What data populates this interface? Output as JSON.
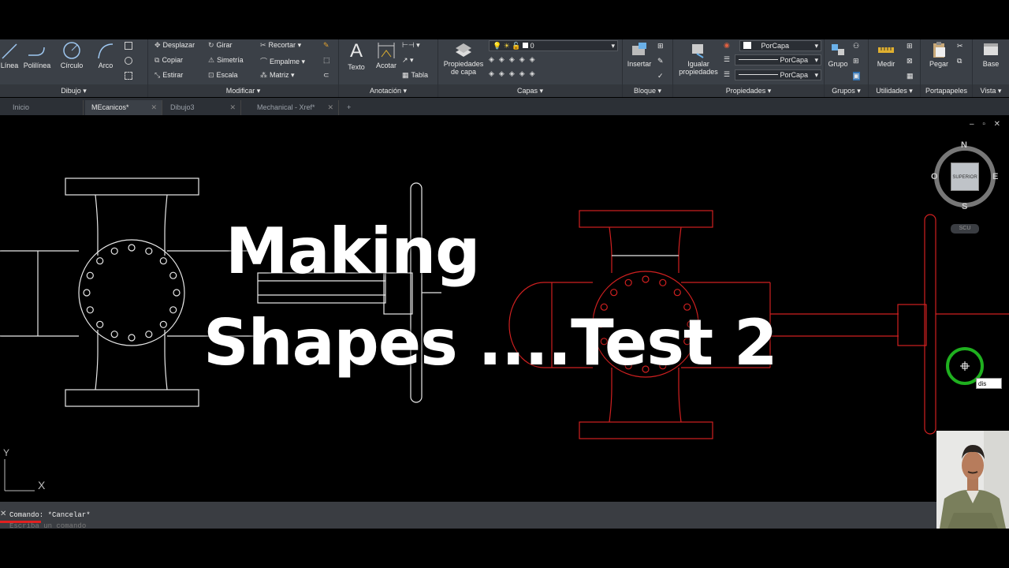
{
  "ribbon": {
    "dibujo": {
      "title": "Dibujo",
      "linea": "Línea",
      "polilinea": "Polilínea",
      "circulo": "Círculo",
      "arco": "Arco"
    },
    "modificar": {
      "title": "Modificar",
      "desplazar": "Desplazar",
      "girar": "Girar",
      "recortar": "Recortar",
      "copiar": "Copiar",
      "simetria": "Simetría",
      "empalme": "Empalme",
      "estirar": "Estirar",
      "escala": "Escala",
      "matriz": "Matriz"
    },
    "anotacion": {
      "title": "Anotación",
      "texto": "Texto",
      "acotar": "Acotar",
      "tabla": "Tabla"
    },
    "capas": {
      "title": "Capas",
      "propiedades_capa": "Propiedades de capa",
      "layer_value": "0"
    },
    "bloque": {
      "title": "Bloque",
      "insertar": "Insertar"
    },
    "propiedades": {
      "title": "Propiedades",
      "igualar": "Igualar propiedades",
      "color": "PorCapa",
      "linetype": "PorCapa",
      "lineweight": "PorCapa"
    },
    "grupos": {
      "title": "Grupos",
      "grupo": "Grupo"
    },
    "utilidades": {
      "title": "Utilidades",
      "medir": "Medir"
    },
    "portapapeles": {
      "title": "Portapapeles",
      "pegar": "Pegar"
    },
    "vista": {
      "title": "Vista",
      "base": "Base"
    }
  },
  "tabs": [
    {
      "label": "Inicio",
      "active": false,
      "closable": false
    },
    {
      "label": "MEcanicos*",
      "active": true,
      "closable": true
    },
    {
      "label": "Dibujo3",
      "active": false,
      "closable": true
    },
    {
      "label": "Mechanical - Xref*",
      "active": false,
      "closable": true
    }
  ],
  "tab_add": "+",
  "overlay": {
    "line1": "Making",
    "line2": "Shapes ....Test 2"
  },
  "viewcube": {
    "n": "N",
    "s": "S",
    "e": "E",
    "o": "O",
    "face": "SUPERIOR",
    "wcs": "SCU"
  },
  "ucs": {
    "x": "X",
    "y": "Y"
  },
  "command": {
    "text": "Comando: *Cancelar*",
    "prompt": "Escriba un comando"
  },
  "dynamic_input": "dis",
  "window_controls": "– ▫ ✕",
  "colors": {
    "drawing_white": "#e8e8e8",
    "drawing_red": "#d02020",
    "ribbon_bg": "#3b4047",
    "canvas_bg": "#000000",
    "cursor_ring": "#1fb01f"
  }
}
